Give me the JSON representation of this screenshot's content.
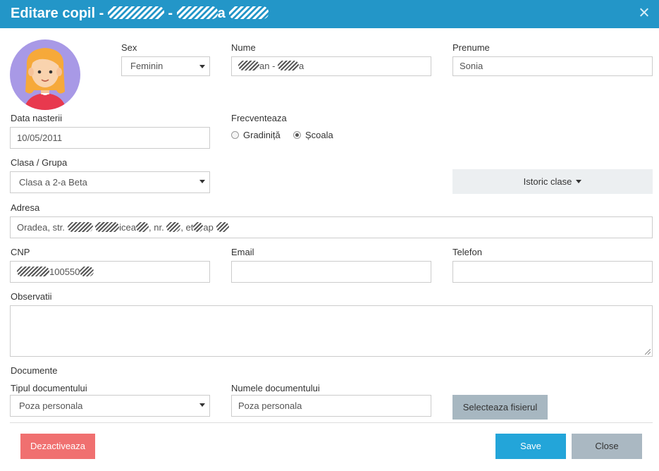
{
  "dialog": {
    "title_prefix": "Editare copil - ",
    "title_mid": " - ",
    "title_a": "a"
  },
  "form": {
    "sex": {
      "label": "Sex",
      "value": "Feminin"
    },
    "nume": {
      "label": "Nume",
      "part1": "an - ",
      "part2": "a"
    },
    "prenume": {
      "label": "Prenume",
      "value": "Sonia"
    },
    "data_nasterii": {
      "label": "Data nasterii",
      "value": "10/05/2011"
    },
    "frecventeaza": {
      "label": "Frecventeaza",
      "options": [
        "Gradiniță",
        "Școala"
      ],
      "selected": "Școala"
    },
    "clasa": {
      "label": "Clasa / Grupa",
      "value": "Clasa a 2-a Beta"
    },
    "istoric_button": "Istoric clase",
    "adresa": {
      "label": "Adresa",
      "p1": "Oradea, str. ",
      "p2": "icea",
      "p3": ", nr. ",
      "p4": ", et",
      "p5": "ap"
    },
    "cnp": {
      "label": "CNP",
      "visible_part": "100550"
    },
    "email": {
      "label": "Email",
      "value": ""
    },
    "telefon": {
      "label": "Telefon",
      "value": ""
    },
    "observatii": {
      "label": "Observatii",
      "value": ""
    },
    "documente": {
      "section_label": "Documente",
      "tip_label": "Tipul documentului",
      "tip_value": "Poza personala",
      "nume_label": "Numele documentului",
      "nume_value": "Poza personala",
      "select_file_button": "Selecteaza fisierul"
    }
  },
  "footer": {
    "deactivate": "Dezactiveaza",
    "save": "Save",
    "close": "Close"
  },
  "colors": {
    "header": "#2396c8",
    "deactivate": "#f07070",
    "save": "#23a5d9",
    "close": "#aab8c2",
    "select_file": "#a7b7c1",
    "avatar_bg": "#a899e6"
  }
}
